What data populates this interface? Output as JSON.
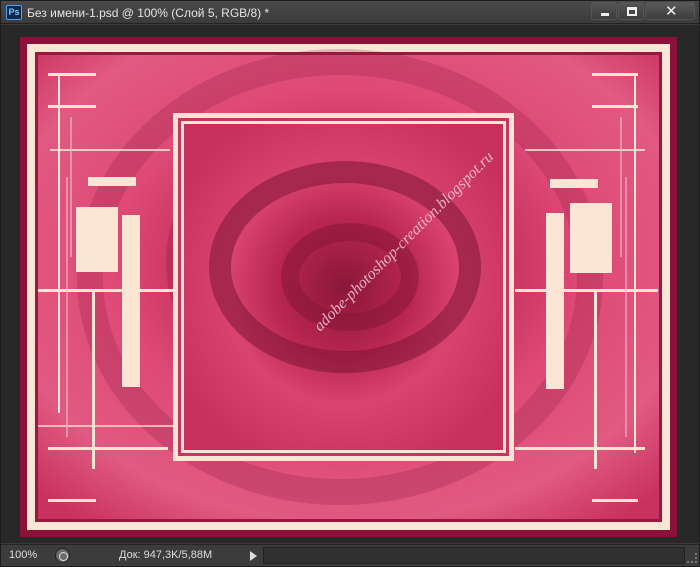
{
  "window": {
    "title": "Без имени-1.psd @ 100% (Слой 5, RGB/8) *",
    "app_icon": "Ps",
    "controls": {
      "minimize": "minimize-icon",
      "maximize": "maximize-icon",
      "close": "✕"
    }
  },
  "canvas": {
    "watermark": "adobe-photoshop-creation.blogspot.ru",
    "colors": {
      "frame": "#8c1138",
      "cream": "#fbe6d6",
      "pink": "#d43a68",
      "dark": "#7a1230"
    }
  },
  "status": {
    "zoom": "100%",
    "doc_info": "Док: 947,3K/5,88M"
  }
}
